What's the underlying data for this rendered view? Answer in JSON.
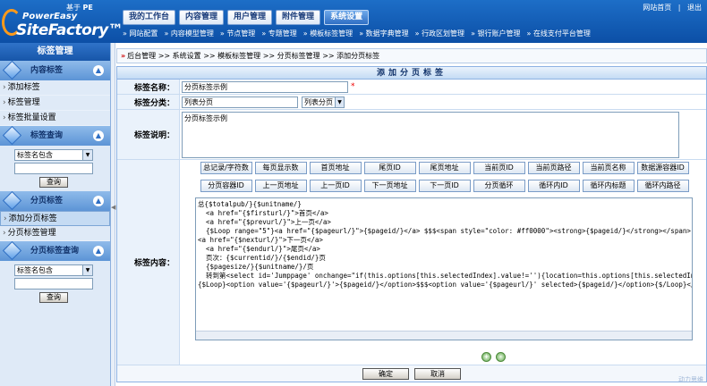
{
  "header": {
    "based_on": "基于",
    "brand_mark": "PE",
    "brand_power": "PowerEasy",
    "brand_site": "SiteFactory™",
    "top_links": [
      "网站首页",
      "|",
      "退出"
    ],
    "tabs": [
      {
        "label": "我的工作台",
        "active": false
      },
      {
        "label": "内容管理",
        "active": false
      },
      {
        "label": "用户管理",
        "active": false
      },
      {
        "label": "附件管理",
        "active": false
      },
      {
        "label": "系统设置",
        "active": true
      }
    ],
    "subnav": [
      "» 网站配置",
      "» 内容模型管理",
      "» 节点管理",
      "» 专题管理",
      "» 模板标签管理",
      "» 数据字典管理",
      "» 行政区划管理",
      "» 银行账户管理",
      "» 在线支付平台管理"
    ]
  },
  "sidebar": {
    "title": "标签管理",
    "section1": {
      "title": "内容标签",
      "items": [
        "添加标签",
        "标签管理",
        "标签批量设置"
      ]
    },
    "section2": {
      "title": "标签查询",
      "select_value": "标签名包含",
      "search_button": "查询"
    },
    "section3": {
      "title": "分页标签",
      "items": [
        "添加分页标签",
        "分页标签管理"
      ]
    },
    "section4": {
      "title": "分页标签查询",
      "select_value": "标签名包含",
      "search_button": "查询"
    }
  },
  "breadcrumb": "后台管理 >> 系统设置 >> 模板标签管理 >> 分页标签管理 >> 添加分页标签",
  "form": {
    "title": "添加分页标签",
    "name_label": "标签名称：",
    "name_value": "分页标签示例",
    "required_mark": "*",
    "category_label": "标签分类：",
    "category_value": "列表分页",
    "category_select": "列表分页",
    "desc_label": "标签说明：",
    "desc_value": "分页标签示例",
    "content_label": "标签内容：",
    "buttons_row1": [
      "总记录/字符数",
      "每页显示数",
      "首页地址",
      "尾页ID",
      "尾页地址",
      "当前页ID",
      "当前页路径",
      "当前页名称",
      "数据源容器ID"
    ],
    "buttons_row2": [
      "分页容器ID",
      "上一页地址",
      "上一页ID",
      "下一页地址",
      "下一页ID",
      "分页循环",
      "循环内ID",
      "循环内标题",
      "循环内路径"
    ],
    "code": "总{$totalpub/}{$unitname/}\n  <a href=\"{$firsturl/}\">首页</a>\n  <a href=\"{$prevurl/}\">上一页</a>\n  {$Loop range=\"5\"}<a href=\"{$pageurl/}\">{$pageid/}</a> $$$<span style=\"color: #ff0000\"><strong>{$pageid/}</strong></span> {$/Loop}\n<a href=\"{$nexturl/}\">下一页</a>\n  <a href=\"{$endurl/}\">尾页</a>\n  页次：{$currentid/}/{$endid/}页\n  {$pagesize/}{$unitname/}/页\n  转到第<select id='Jumppage' onchange=\"if(this.options[this.selectedIndex].value!=''){location=this.options[this.selectedIndex].value;}\">\n{$Loop}<option value='{$pageurl/}'>{$pageid/}</option>$$$<option value='{$pageurl/}' selected>{$pageid/}</option>{$/Loop}</select>页",
    "expand_icons": [
      "+",
      "-"
    ],
    "ok_button": "确定",
    "cancel_button": "取消"
  },
  "watermark": "动力思维"
}
